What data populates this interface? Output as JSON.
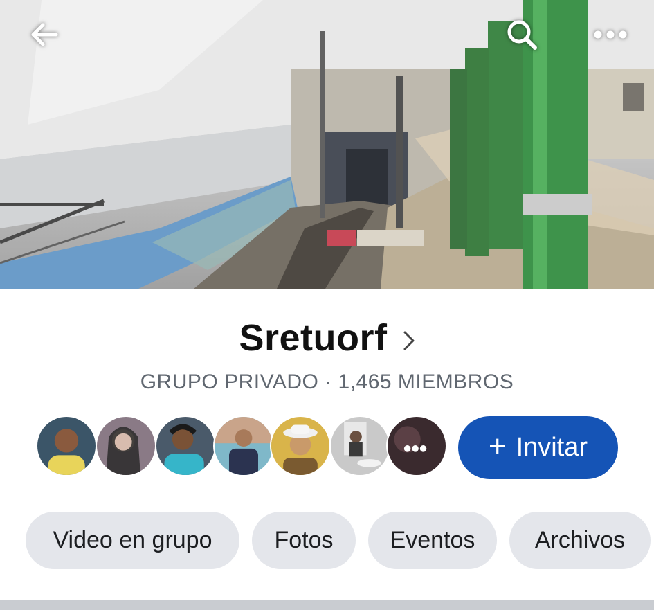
{
  "group": {
    "name": "Sretuorf",
    "subtitle": "GRUPO PRIVADO · 1,465 MIEMBROS"
  },
  "toolbar": {
    "back_icon": "arrow-left-icon",
    "search_icon": "search-icon",
    "more_icon": "more-horizontal-icon"
  },
  "members": {
    "avatars": [
      {
        "name": "member-avatar-1",
        "bg": "#3b5568",
        "accent": "#e8d45a"
      },
      {
        "name": "member-avatar-2",
        "bg": "#8a7a86",
        "accent": "#2a2a2a"
      },
      {
        "name": "member-avatar-3",
        "bg": "#4a5a6a",
        "accent": "#36b5c9"
      },
      {
        "name": "member-avatar-4",
        "bg": "#7fb8c9",
        "accent": "#2b3350"
      },
      {
        "name": "member-avatar-5",
        "bg": "#d9b44a",
        "accent": "#7a5a30"
      },
      {
        "name": "member-avatar-6",
        "bg": "#c9c9c9",
        "accent": "#3a3a3a"
      },
      {
        "name": "member-avatar-7",
        "bg": "#3a2a2e",
        "accent": "#ffffff"
      }
    ],
    "invite_label": "Invitar",
    "invite_plus": "+"
  },
  "tabs": [
    {
      "label": "Video en grupo"
    },
    {
      "label": "Fotos"
    },
    {
      "label": "Eventos"
    },
    {
      "label": "Archivos"
    }
  ],
  "colors": {
    "accent": "#1554b6",
    "pill": "#e4e6eb",
    "subtitle": "#606770"
  }
}
